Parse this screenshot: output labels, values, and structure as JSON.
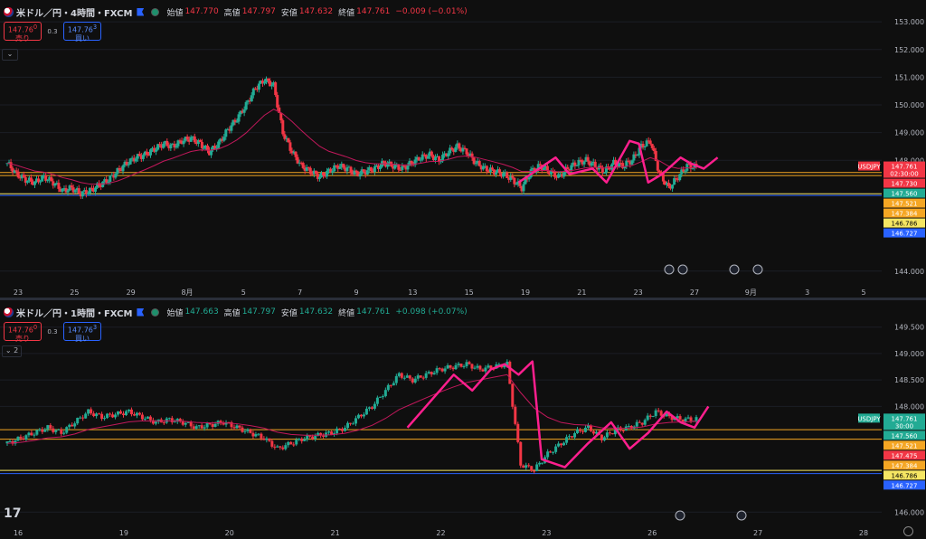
{
  "colors": {
    "up": "#22ab94",
    "down": "#f23645",
    "ma": "#c2185b",
    "drawing": "#ff1f8e",
    "orange": "#f5a623",
    "yellow": "#f5e663",
    "blue": "#2962ff",
    "green": "#22ab94",
    "grid": "#1b1e26"
  },
  "panes": [
    {
      "header": {
        "symbol": "米ドル／円・4時間・FXCM",
        "open_label": "始値",
        "open": "147.770",
        "high_label": "高値",
        "high": "147.797",
        "low_label": "安値",
        "low": "147.632",
        "close_label": "終値",
        "close": "147.761",
        "change": "−0.009 (−0.01%)",
        "change_dir": "down"
      },
      "trade": {
        "sell_price": "147.76",
        "sell_sup": "0",
        "sell_label": "売り",
        "spread": "0.3",
        "buy_price": "147.76",
        "buy_sup": "3",
        "buy_label": "買い"
      },
      "collapse_label": "⌄",
      "chart_data": {
        "type": "candlestick",
        "ylim": [
          143.6,
          153.2
        ],
        "y_ticks": [
          "153.000",
          "152.000",
          "151.000",
          "150.000",
          "149.000",
          "148.000",
          "144.000"
        ],
        "y_tick_values": [
          153,
          152,
          151,
          150,
          149,
          148,
          144
        ],
        "x_labels": [
          "23",
          "25",
          "29",
          "8月",
          "5",
          "7",
          "9",
          "13",
          "15",
          "19",
          "21",
          "23",
          "27",
          "9月",
          "3",
          "5"
        ],
        "close_path": [
          147.9,
          147.5,
          147.3,
          147.2,
          147.4,
          147.2,
          146.9,
          147.0,
          146.8,
          146.9,
          147.1,
          147.3,
          147.6,
          147.9,
          148.1,
          148.2,
          148.4,
          148.6,
          148.5,
          148.7,
          148.8,
          148.6,
          148.3,
          148.6,
          149.1,
          149.5,
          150.0,
          150.6,
          150.9,
          150.7,
          149.0,
          148.3,
          147.8,
          147.6,
          147.4,
          147.6,
          147.8,
          147.7,
          147.5,
          147.6,
          147.7,
          147.9,
          147.8,
          147.7,
          147.9,
          148.1,
          148.2,
          148.0,
          148.3,
          148.5,
          148.3,
          147.9,
          147.7,
          147.6,
          147.5,
          147.3,
          147.0,
          147.6,
          147.8,
          147.6,
          147.4,
          147.7,
          147.9,
          148.0,
          147.8,
          147.6,
          147.9,
          147.8,
          148.0,
          148.5,
          148.7,
          147.5,
          147.0,
          147.4,
          147.8,
          147.76
        ],
        "price_levels": [
          {
            "label": "147.761",
            "value": 147.761,
            "color": "#f23645",
            "sub": "02:30:00"
          },
          {
            "label": "147.730",
            "value": 147.73,
            "color": "#f23645"
          },
          {
            "label": "147.560",
            "value": 147.56,
            "color": "#22ab94"
          },
          {
            "label": "147.521",
            "value": 147.521,
            "color": "#f5a623"
          },
          {
            "label": "147.384",
            "value": 147.384,
            "color": "#f5a623"
          },
          {
            "label": "146.786",
            "value": 146.786,
            "color": "#f5e663"
          },
          {
            "label": "146.727",
            "value": 146.727,
            "color": "#2962ff"
          }
        ],
        "hlines": [
          {
            "value": 147.56,
            "color": "#f5a623"
          },
          {
            "value": 147.45,
            "color": "#f5a623"
          },
          {
            "value": 146.79,
            "color": "#f5e663"
          },
          {
            "value": 146.73,
            "color": "#2962ff"
          }
        ],
        "drawing": [
          [
            0.56,
            147.2
          ],
          [
            0.6,
            148.1
          ],
          [
            0.615,
            147.5
          ],
          [
            0.64,
            147.7
          ],
          [
            0.655,
            147.2
          ],
          [
            0.665,
            147.8
          ],
          [
            0.68,
            148.7
          ],
          [
            0.69,
            148.6
          ],
          [
            0.7,
            147.2
          ],
          [
            0.715,
            147.5
          ],
          [
            0.735,
            148.1
          ],
          [
            0.745,
            147.9
          ],
          [
            0.76,
            147.7
          ],
          [
            0.775,
            148.1
          ]
        ],
        "symbol_tag": "USDJPY"
      }
    },
    {
      "header": {
        "symbol": "米ドル／円・1時間・FXCM",
        "open_label": "始値",
        "open": "147.663",
        "high_label": "高値",
        "high": "147.797",
        "low_label": "安値",
        "low": "147.632",
        "close_label": "終値",
        "close": "147.761",
        "change": "+0.098 (+0.07%)",
        "change_dir": "up"
      },
      "trade": {
        "sell_price": "147.76",
        "sell_sup": "0",
        "sell_label": "売り",
        "spread": "0.3",
        "buy_price": "147.76",
        "buy_sup": "3",
        "buy_label": "買い"
      },
      "collapse_label": "⌄ 2",
      "chart_data": {
        "type": "candlestick",
        "ylim": [
          145.8,
          149.7
        ],
        "y_ticks": [
          "149.500",
          "149.000",
          "148.500",
          "148.000",
          "146.000"
        ],
        "y_tick_values": [
          149.5,
          149,
          148.5,
          148,
          146
        ],
        "x_labels": [
          "16",
          "19",
          "20",
          "21",
          "22",
          "23",
          "26",
          "27",
          "28"
        ],
        "close_path": [
          147.3,
          147.4,
          147.5,
          147.6,
          147.5,
          147.7,
          147.9,
          147.8,
          147.85,
          147.9,
          147.8,
          147.7,
          147.75,
          147.7,
          147.6,
          147.65,
          147.7,
          147.6,
          147.5,
          147.4,
          147.2,
          147.3,
          147.4,
          147.45,
          147.5,
          147.6,
          147.8,
          148.0,
          148.3,
          148.6,
          148.5,
          148.6,
          148.7,
          148.75,
          148.8,
          148.7,
          148.75,
          148.8,
          146.9,
          146.8,
          147.1,
          147.3,
          147.5,
          147.6,
          147.4,
          147.55,
          147.6,
          147.7,
          147.9,
          147.8,
          147.75,
          147.76
        ],
        "price_levels": [
          {
            "label": "147.761",
            "value": 147.761,
            "color": "#22ab94",
            "sub": "30:00"
          },
          {
            "label": "147.560",
            "value": 147.56,
            "color": "#22ab94"
          },
          {
            "label": "147.521",
            "value": 147.521,
            "color": "#f5a623"
          },
          {
            "label": "147.475",
            "value": 147.475,
            "color": "#f23645"
          },
          {
            "label": "147.384",
            "value": 147.384,
            "color": "#f5a623"
          },
          {
            "label": "146.786",
            "value": 146.786,
            "color": "#f5e663"
          },
          {
            "label": "146.727",
            "value": 146.727,
            "color": "#2962ff"
          }
        ],
        "hlines": [
          {
            "value": 147.56,
            "color": "#f5a623"
          },
          {
            "value": 147.38,
            "color": "#f5a623"
          },
          {
            "value": 146.79,
            "color": "#f5e663"
          },
          {
            "value": 146.73,
            "color": "#2962ff"
          }
        ],
        "drawing": [
          [
            0.44,
            147.6
          ],
          [
            0.465,
            148.1
          ],
          [
            0.49,
            148.6
          ],
          [
            0.51,
            148.3
          ],
          [
            0.53,
            148.7
          ],
          [
            0.545,
            148.8
          ],
          [
            0.56,
            148.6
          ],
          [
            0.575,
            148.85
          ],
          [
            0.585,
            147.0
          ],
          [
            0.61,
            146.85
          ],
          [
            0.635,
            147.3
          ],
          [
            0.66,
            147.7
          ],
          [
            0.68,
            147.2
          ],
          [
            0.7,
            147.5
          ],
          [
            0.72,
            147.9
          ],
          [
            0.735,
            147.7
          ],
          [
            0.75,
            147.6
          ],
          [
            0.765,
            148.0
          ]
        ],
        "symbol_tag": "USDJPY"
      }
    }
  ]
}
